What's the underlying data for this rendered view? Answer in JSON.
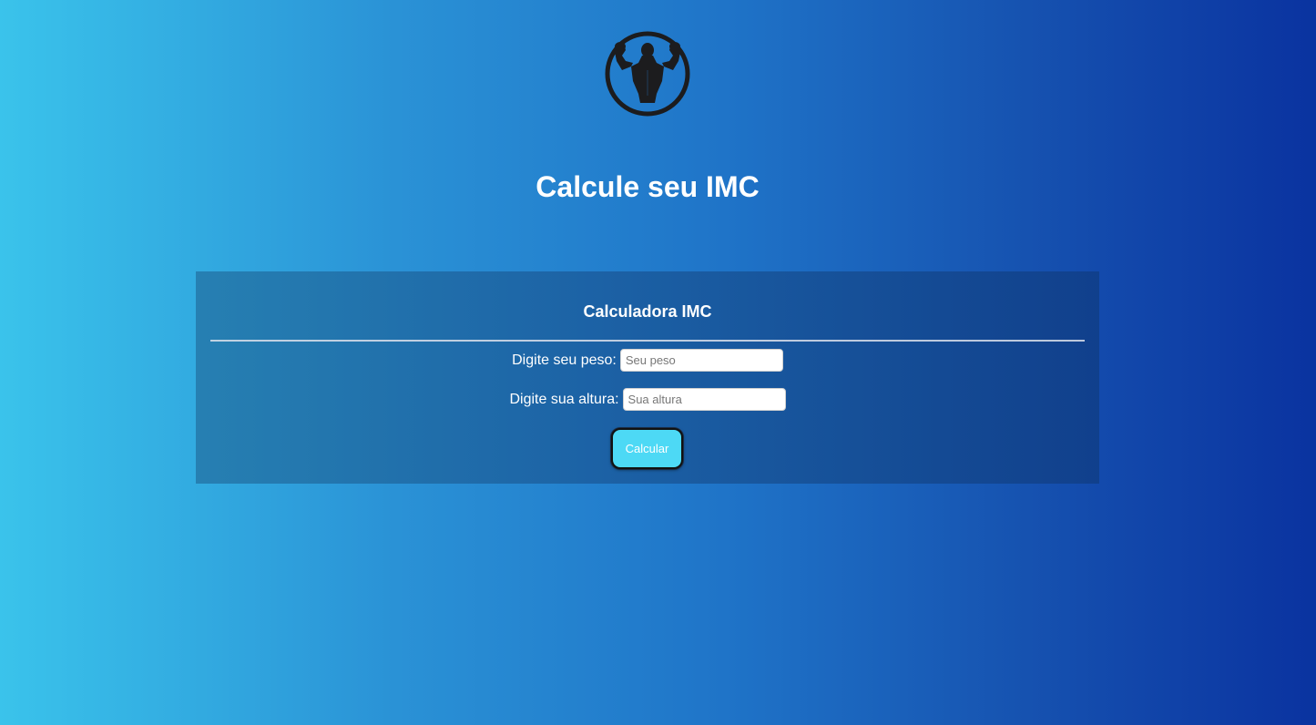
{
  "header": {
    "logo_icon": "bodybuilder-logo-icon",
    "title": "Calcule seu IMC"
  },
  "calculator": {
    "title": "Calculadora IMC",
    "weight": {
      "label": "Digite seu peso:",
      "placeholder": "Seu peso",
      "value": ""
    },
    "height": {
      "label": "Digite sua altura:",
      "placeholder": "Sua altura",
      "value": ""
    },
    "button_label": "Calcular"
  },
  "colors": {
    "background_start": "#3ac3eb",
    "background_end": "#0a33a0",
    "button": "#4dd9f5",
    "text": "#ffffff"
  }
}
